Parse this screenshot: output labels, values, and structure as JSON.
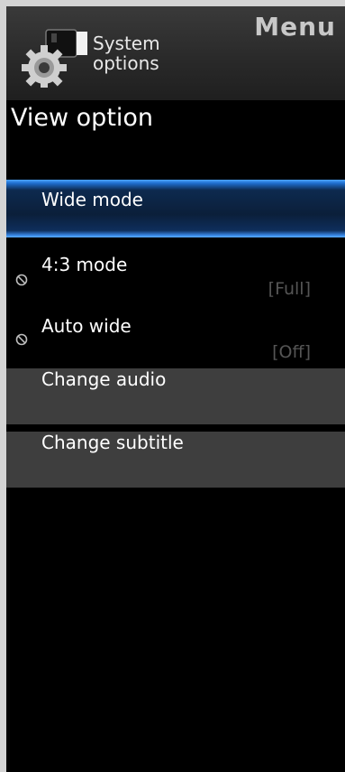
{
  "header": {
    "menu_title": "Menu",
    "section_line1": "System",
    "section_line2": "options",
    "icon": "gear-projector-icon"
  },
  "page_title": "View option",
  "items": [
    {
      "label": "Wide mode",
      "value": "",
      "state": "selected"
    },
    {
      "label": "4:3 mode",
      "value": "[Full]",
      "state": "disabled",
      "icon": "prohibited-icon"
    },
    {
      "label": "Auto wide",
      "value": "[Off]",
      "state": "disabled",
      "icon": "prohibited-icon"
    },
    {
      "label": "Change audio",
      "value": "",
      "state": "normal"
    },
    {
      "label": "Change subtitle",
      "value": "",
      "state": "normal"
    }
  ],
  "colors": {
    "background": "#000000",
    "selection_blue": "#1f6fd0",
    "item_gray": "#3e3e3e",
    "disabled_value": "#555555"
  }
}
